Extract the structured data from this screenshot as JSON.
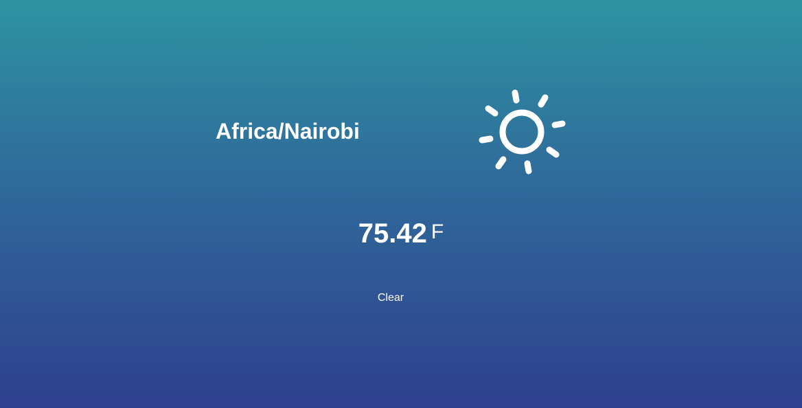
{
  "weather": {
    "timezone": "Africa/Nairobi",
    "temperature": "75.42",
    "unit": "F",
    "description": "Clear",
    "icon": "sun-icon"
  }
}
